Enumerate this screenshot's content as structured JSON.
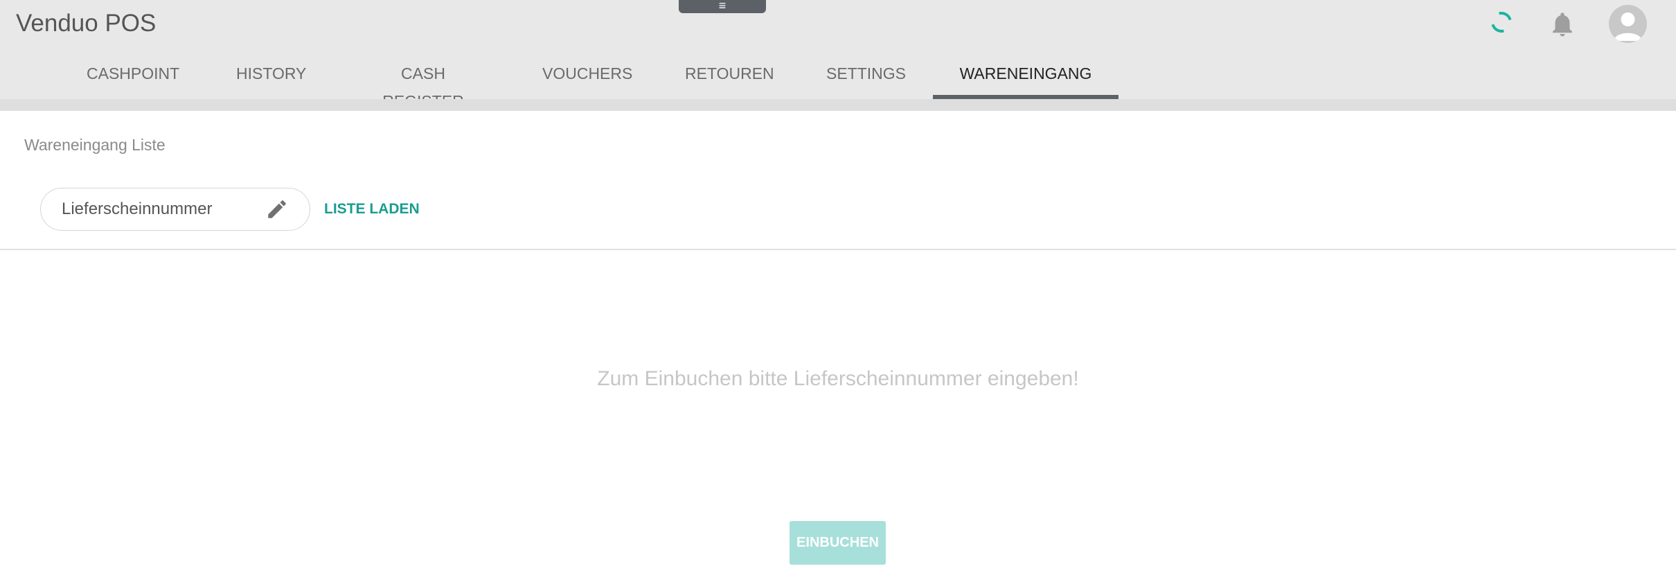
{
  "app": {
    "title": "Venduo POS"
  },
  "header": {
    "menu_toggle_icon": "hamburger-icon",
    "loading_icon": "spinner-icon",
    "notification_icon": "bell-icon",
    "user_icon": "avatar-icon",
    "accent_color": "#1ab5a1"
  },
  "tabs": [
    {
      "label": "CASHPOINT",
      "active": false
    },
    {
      "label": "HISTORY",
      "active": false
    },
    {
      "label": "CASH REGISTER",
      "active": false
    },
    {
      "label": "VOUCHERS",
      "active": false
    },
    {
      "label": "RETOUREN",
      "active": false
    },
    {
      "label": "SETTINGS",
      "active": false
    },
    {
      "label": "WARENEINGANG",
      "active": true
    }
  ],
  "main": {
    "section_title": "Wareneingang Liste",
    "delivery_note_input": {
      "value": "",
      "placeholder": "Lieferscheinnummer",
      "icon": "pencil-icon"
    },
    "load_list_label": "LISTE LADEN",
    "empty_message": "Zum Einbuchen bitte Lieferscheinnummer eingeben!",
    "book_button_label": "EINBUCHEN",
    "book_button_disabled": true
  }
}
